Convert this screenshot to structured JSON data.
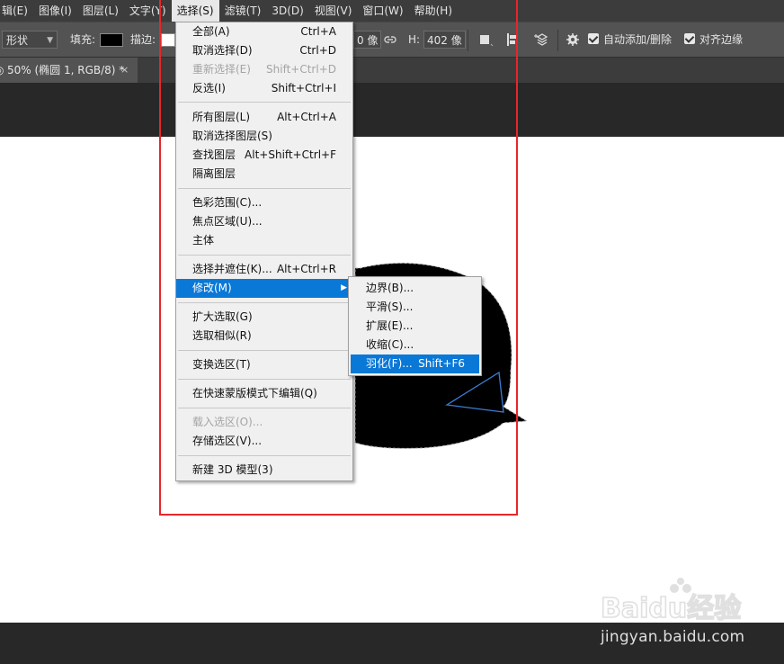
{
  "menubar": {
    "items": [
      "辑(E)",
      "图像(I)",
      "图层(L)",
      "文字(Y)",
      "选择(S)",
      "滤镜(T)",
      "3D(D)",
      "视图(V)",
      "窗口(W)",
      "帮助(H)"
    ]
  },
  "options": {
    "shape_mode": "形状",
    "fill_label": "填充:",
    "stroke_label": "描边:",
    "w_value": "0 像",
    "h_label": "H:",
    "h_value": "402 像",
    "auto_add_delete": "自动添加/删除",
    "align_edges": "对齐边缘"
  },
  "document_tab": {
    "title": "50% (椭圆 1, RGB/8) *",
    "close": "×"
  },
  "select_menu": {
    "items": [
      {
        "label": "全部(A)",
        "shortcut": "Ctrl+A"
      },
      {
        "label": "取消选择(D)",
        "shortcut": "Ctrl+D"
      },
      {
        "label": "重新选择(E)",
        "shortcut": "Shift+Ctrl+D"
      },
      {
        "label": "反选(I)",
        "shortcut": "Shift+Ctrl+I"
      },
      {
        "label": "所有图层(L)",
        "shortcut": "Alt+Ctrl+A"
      },
      {
        "label": "取消选择图层(S)",
        "shortcut": ""
      },
      {
        "label": "查找图层",
        "shortcut": "Alt+Shift+Ctrl+F"
      },
      {
        "label": "隔离图层",
        "shortcut": ""
      },
      {
        "label": "色彩范围(C)...",
        "shortcut": ""
      },
      {
        "label": "焦点区域(U)...",
        "shortcut": ""
      },
      {
        "label": "主体",
        "shortcut": ""
      },
      {
        "label": "选择并遮住(K)...",
        "shortcut": "Alt+Ctrl+R"
      },
      {
        "label": "修改(M)",
        "shortcut": ""
      },
      {
        "label": "扩大选取(G)",
        "shortcut": ""
      },
      {
        "label": "选取相似(R)",
        "shortcut": ""
      },
      {
        "label": "变换选区(T)",
        "shortcut": ""
      },
      {
        "label": "在快速蒙版模式下编辑(Q)",
        "shortcut": ""
      },
      {
        "label": "载入选区(O)...",
        "shortcut": ""
      },
      {
        "label": "存储选区(V)...",
        "shortcut": ""
      },
      {
        "label": "新建 3D 模型(3)",
        "shortcut": ""
      }
    ]
  },
  "modify_submenu": {
    "items": [
      {
        "label": "边界(B)...",
        "shortcut": ""
      },
      {
        "label": "平滑(S)...",
        "shortcut": ""
      },
      {
        "label": "扩展(E)...",
        "shortcut": ""
      },
      {
        "label": "收缩(C)...",
        "shortcut": ""
      },
      {
        "label": "羽化(F)...",
        "shortcut": "Shift+F6"
      }
    ]
  },
  "watermark": {
    "logo_text": "Baidu经验",
    "url": "jingyan.baidu.com"
  },
  "colors": {
    "menu_highlight": "#0a78d7",
    "annotation_border": "#e8262a",
    "ui_dark": "#535353"
  }
}
